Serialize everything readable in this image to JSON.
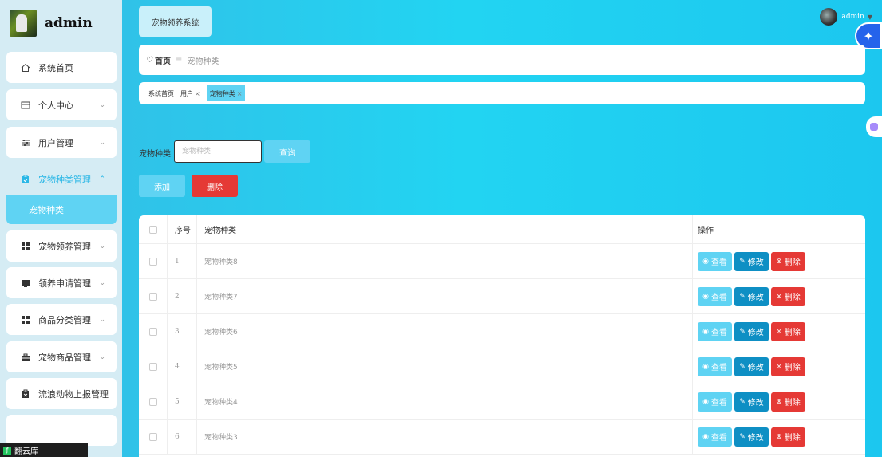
{
  "app": {
    "brand_name": "admin",
    "system_tab": "宠物领养系统",
    "user_name": "admin"
  },
  "sidebar": {
    "items": [
      {
        "label": "系统首页",
        "icon": "home-icon",
        "has_chevron": false
      },
      {
        "label": "个人中心",
        "icon": "card-icon",
        "has_chevron": true
      },
      {
        "label": "用户管理",
        "icon": "sliders-icon",
        "has_chevron": true
      },
      {
        "label": "宠物种类管理",
        "icon": "clipboard-icon",
        "has_chevron": true,
        "active": true
      },
      {
        "label": "宠物领养管理",
        "icon": "grid-icon",
        "has_chevron": true
      },
      {
        "label": "领养申请管理",
        "icon": "monitor-icon",
        "has_chevron": true
      },
      {
        "label": "商品分类管理",
        "icon": "grid-icon",
        "has_chevron": true
      },
      {
        "label": "宠物商品管理",
        "icon": "briefcase-icon",
        "has_chevron": true
      },
      {
        "label": "流浪动物上报管理",
        "icon": "clipboard-icon",
        "has_chevron": false
      }
    ],
    "submenu_item": "宠物种类",
    "taskbar_label": "翻云库"
  },
  "breadcrumb": {
    "home": "首页",
    "separator": "≡",
    "current": "宠物种类"
  },
  "tags": [
    {
      "label": "系统首页",
      "closable": false,
      "active": false
    },
    {
      "label": "用户",
      "closable": true,
      "active": false
    },
    {
      "label": "宠物种类",
      "closable": true,
      "active": true
    }
  ],
  "tag_close": "×",
  "search": {
    "label": "宠物种类",
    "placeholder": "宠物种类",
    "query_button": "查询"
  },
  "toolbar": {
    "add_label": "添加",
    "delete_label": "删除"
  },
  "table": {
    "headers": {
      "index": "序号",
      "name": "宠物种类",
      "actions": "操作"
    },
    "action_labels": {
      "view": "查看",
      "edit": "修改",
      "delete": "删除"
    },
    "rows": [
      {
        "index": "1",
        "name": "宠物种类8"
      },
      {
        "index": "2",
        "name": "宠物种类7"
      },
      {
        "index": "3",
        "name": "宠物种类6"
      },
      {
        "index": "4",
        "name": "宠物种类5"
      },
      {
        "index": "5",
        "name": "宠物种类4"
      },
      {
        "index": "6",
        "name": "宠物种类3"
      }
    ]
  },
  "colors": {
    "accent": "#5fd3f3",
    "danger": "#e53935",
    "edit": "#0e8fc4",
    "sidebar_bg": "#d5ecf4"
  }
}
